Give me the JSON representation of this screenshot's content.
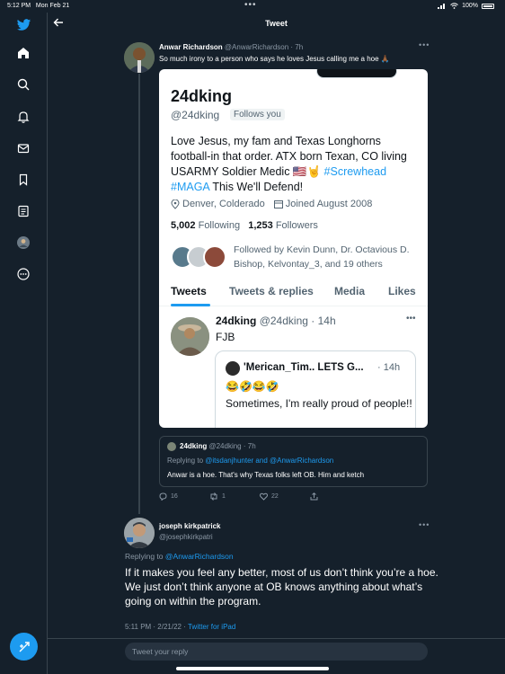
{
  "status_bar": {
    "time": "5:12 PM",
    "date": "Mon Feb 21",
    "battery": "100%"
  },
  "header": {
    "title": "Tweet"
  },
  "sidebar": {
    "items": [
      "twitter-logo",
      "home",
      "explore",
      "notifications",
      "messages",
      "bookmarks",
      "lists",
      "profile",
      "more"
    ]
  },
  "tweet": {
    "name": "Anwar Richardson",
    "handle": "@AnwarRichardson",
    "time": "· 7h",
    "text": "So much irony to a person who says he loves Jesus calling me a hoe 🙏🏾"
  },
  "screenshot": {
    "name": "24dking",
    "handle": "@24dking",
    "follows_you": "Follows you",
    "bio_part1": "Love Jesus, my fam and Texas Longhorns football-in that order. ATX born Texan, CO living USARMY Soldier Medic 🇺🇸🤘 ",
    "bio_hashtag1": "#Screwhead",
    "bio_hashtag2": "#MAGA",
    "bio_part2": " This We'll Defend!",
    "location": "Denver, Colderado",
    "joined": "Joined August 2008",
    "following_count": "5,002",
    "following_label": "Following",
    "followers_count": "1,253",
    "followers_label": "Followers",
    "followed_by": "Followed by Kevin Dunn, Dr. Octavious D. Bishop, Kelvontay_3, and 19 others",
    "tabs": [
      "Tweets",
      "Tweets & replies",
      "Media",
      "Likes"
    ],
    "inner_tweet": {
      "name": "24dking",
      "handle": "@24dking",
      "time": "· 14h",
      "text": "FJB",
      "quote": {
        "name": "'Merican_Tim.. LETS G...",
        "time": "· 14h",
        "emoji": "😂🤣😂🤣",
        "text": "Sometimes, I'm really proud of people!!"
      }
    }
  },
  "quoted": {
    "name": "24dking",
    "handle": "@24dking",
    "time": "· 7h",
    "replying_prefix": "Replying to",
    "replying_users": "@itsdanjhunter and @AnwarRichardson",
    "text": "Anwar is a hoe. That's why Texas folks left OB. Him and ketch"
  },
  "actions": {
    "replies": "16",
    "retweets": "1",
    "likes": "22"
  },
  "reply": {
    "name": "joseph kirkpatrick",
    "handle": "@josephkirkpatri",
    "replying_prefix": "Replying to",
    "replying_user": "@AnwarRichardson",
    "text": "If it makes you feel any better, most of us don’t think you’re a hoe.  We just don’t think anyone at OB knows anything about what’s going on within the program.",
    "timestamp": "5:11 PM · 2/21/22 ·",
    "source": "Twitter for iPad"
  },
  "reply_box": {
    "placeholder": "Tweet your reply"
  },
  "colors": {
    "background": "#15202b",
    "accent": "#1d9bf0",
    "muted": "#8b98a5",
    "border": "#38444d"
  }
}
